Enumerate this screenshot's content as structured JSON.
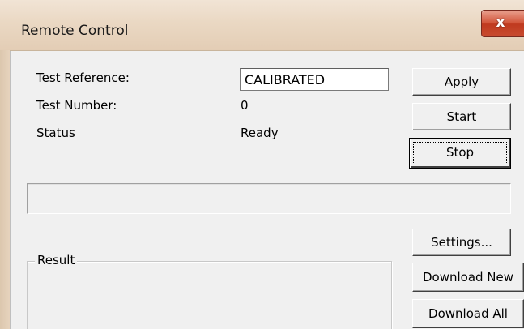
{
  "window": {
    "title": "Remote Control",
    "close_glyph": "x"
  },
  "fields": {
    "test_reference_label": "Test Reference:",
    "test_reference_value": "CALIBRATED",
    "test_number_label": "Test Number:",
    "test_number_value": "0",
    "status_label": "Status",
    "status_value": "Ready"
  },
  "buttons": {
    "apply": "Apply",
    "start": "Start",
    "stop": "Stop",
    "settings": "Settings...",
    "download_new": "Download New",
    "download_all": "Download All"
  },
  "result": {
    "group_label": "Result"
  },
  "progress": {
    "fraction": 0
  },
  "colors": {
    "dialog_bg": "#f0f0f0",
    "titlebar": "#ead8c3",
    "close_button": "#c84b2f"
  },
  "icons": {
    "close": "close-icon"
  }
}
